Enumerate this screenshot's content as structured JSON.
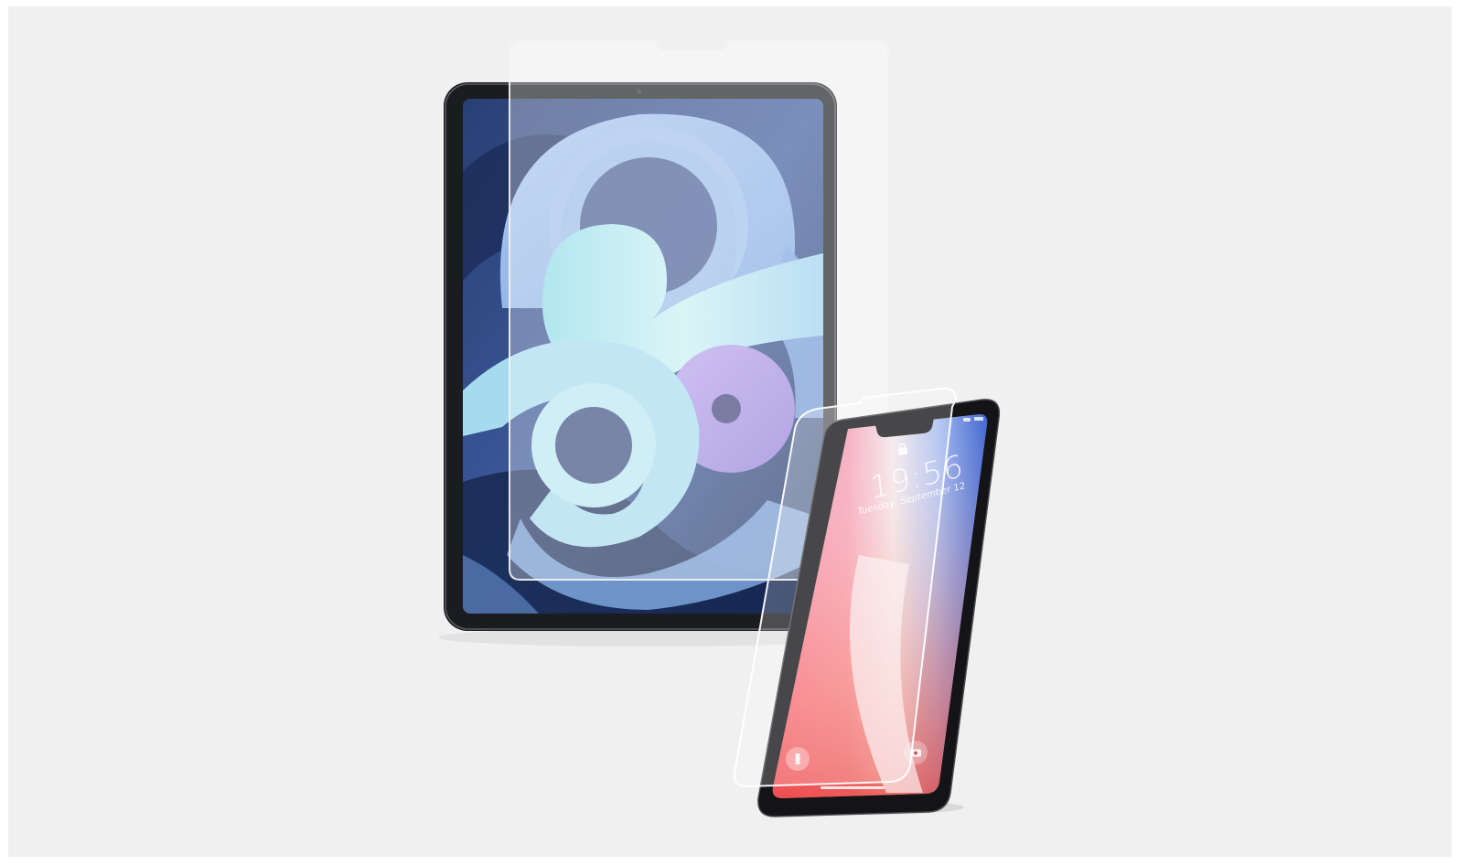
{
  "image": {
    "subject": "tablet-and-phone-screen-protectors",
    "background_color": "#f0f0f0"
  },
  "phone_lock_screen": {
    "time": "19:56",
    "date": "Tuesday, September 12"
  },
  "icons": {
    "lock": "lock-icon",
    "flashlight": "flashlight-icon",
    "camera": "camera-icon"
  },
  "colors": {
    "tablet_bezel": "#1b1c1f",
    "tablet_wallpaper_dark": "#1c2f5c",
    "tablet_wallpaper_blue": "#8fb8e8",
    "tablet_wallpaper_cyan": "#b9ecf2",
    "tablet_wallpaper_purple": "#a48fe0",
    "phone_wallpaper_pink": "#f06aa0",
    "phone_wallpaper_blue": "#3f6fd8",
    "glass": "#ffffff"
  }
}
